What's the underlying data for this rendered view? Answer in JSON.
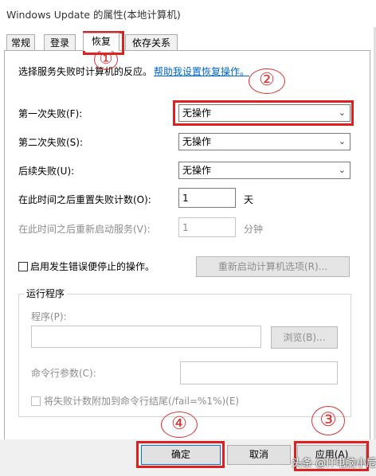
{
  "window": {
    "title": "Windows Update 的属性(本地计算机)"
  },
  "tabs": [
    "常规",
    "登录",
    "恢复",
    "依存关系"
  ],
  "active_tab": 2,
  "recovery": {
    "intro_text": "选择服务失败时计算机的反应。",
    "help_link": "帮助我设置恢复操作。",
    "first_failure": {
      "label": "第一次失败(F):",
      "value": "无操作"
    },
    "second_failure": {
      "label": "第二次失败(S):",
      "value": "无操作"
    },
    "subsequent_failures": {
      "label": "后续失败(U):",
      "value": "无操作"
    },
    "reset_count": {
      "label": "在此时间之后重置失败计数(O):",
      "value": "1",
      "unit": "天"
    },
    "restart_service": {
      "label": "在此时间之后重新启动服务(V):",
      "value": "1",
      "unit": "分钟"
    },
    "stop_with_errors": {
      "label": "启用发生错误便停止的操作。"
    },
    "restart_computer_options_button": "重新启动计算机选项(R)...",
    "run_program": {
      "legend": "运行程序",
      "program_label": "程序(P):",
      "program_value": "",
      "browse_button": "浏览(B)...",
      "cmdline_label": "命令行参数(C):",
      "cmdline_value": "",
      "append_fail_count_label": "将失败计数附加到命令行结尾(/fail=%1%)(E)"
    }
  },
  "dialog_buttons": {
    "ok": "确定",
    "cancel": "取消",
    "apply": "应用(A)"
  },
  "annotations": [
    "①",
    "②",
    "③",
    "④"
  ],
  "watermark": "头条 @IT电脑小卮",
  "colors": {
    "annotation_red": "#e02020",
    "link_blue": "#0066cc"
  }
}
